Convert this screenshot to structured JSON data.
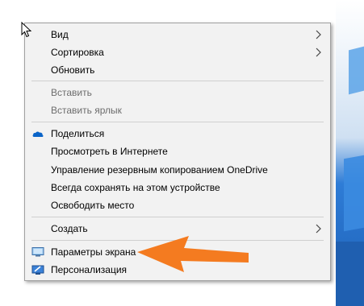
{
  "context_menu": {
    "items": [
      {
        "label": "Вид"
      },
      {
        "label": "Сортировка"
      },
      {
        "label": "Обновить"
      },
      {
        "label": "Вставить"
      },
      {
        "label": "Вставить ярлык"
      },
      {
        "label": "Поделиться"
      },
      {
        "label": "Просмотреть в Интернете"
      },
      {
        "label": "Управление резервным копированием OneDrive"
      },
      {
        "label": "Всегда сохранять на этом устройстве"
      },
      {
        "label": "Освободить место"
      },
      {
        "label": "Создать"
      },
      {
        "label": "Параметры экрана"
      },
      {
        "label": "Персонализация"
      }
    ]
  },
  "icons": {
    "share": "onedrive-cloud-icon",
    "display": "monitor-icon",
    "personalize": "personalize-icon",
    "submenu": "chevron-right-icon"
  },
  "colors": {
    "menu_bg": "#f2f2f2",
    "disabled_text": "#6d6d6d",
    "annotation_arrow": "#f47b20",
    "onedrive_blue": "#0a64c8"
  }
}
